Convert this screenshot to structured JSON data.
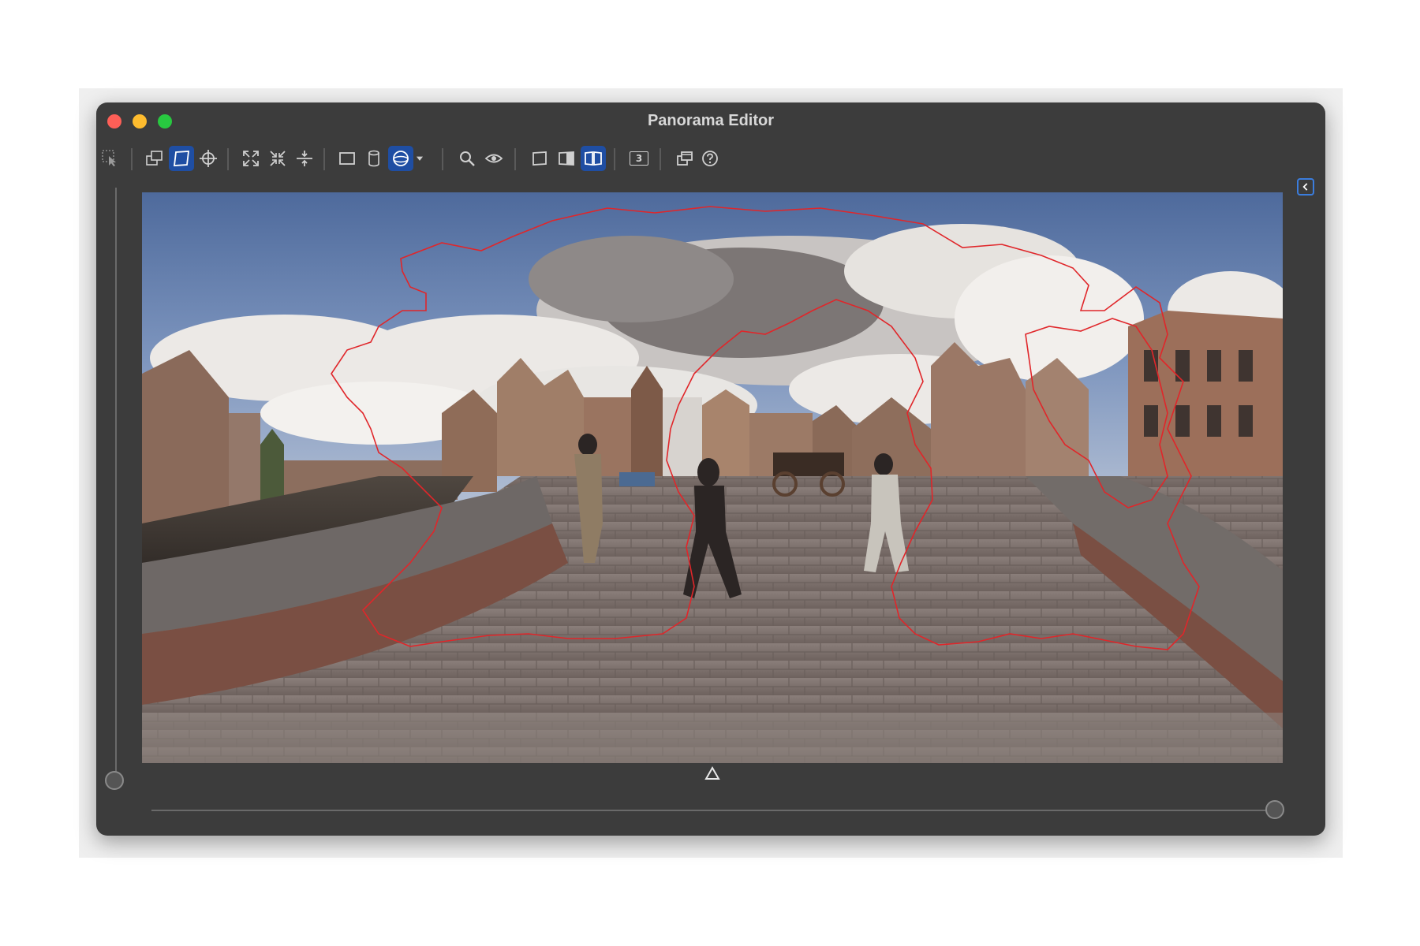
{
  "window": {
    "title": "Panorama Editor"
  },
  "toolbar": {
    "groups": [
      [
        "select-tool"
      ],
      [
        "layer-tool",
        "mask-tool",
        "center-tool"
      ],
      [
        "expand-tool",
        "compress-tool",
        "split-tool"
      ],
      [
        "rect-projection",
        "cylinder-projection",
        "sphere-projection",
        "projection-menu"
      ],
      [
        "zoom-tool",
        "preview-tool"
      ],
      [
        "page-tool",
        "split-view-tool",
        "book-view-tool"
      ],
      [
        "number-3-tool"
      ],
      [
        "windows-tool",
        "help-tool"
      ]
    ],
    "active": [
      "mask-tool",
      "sphere-projection",
      "book-view-tool"
    ],
    "number_badge": "3"
  },
  "colors": {
    "window_bg": "#3c3c3c",
    "active_blue": "#1f4ea3",
    "mask_outline": "#e0262a",
    "icon": "#d0d0d0"
  },
  "sliders": {
    "vertical_value": 0,
    "horizontal_value": 1
  },
  "icons": {
    "collapse": "chevron-left-icon",
    "center_marker": "triangle-up-icon"
  }
}
